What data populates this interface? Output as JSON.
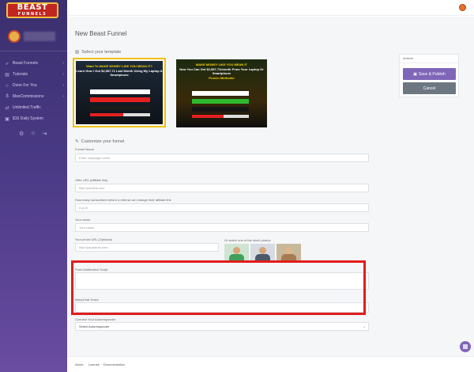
{
  "brand": {
    "line1": "BEAST",
    "line2": "FUNNELS"
  },
  "sidebar": {
    "items": [
      {
        "label": "Beast Funnels",
        "icon": "rocket-icon"
      },
      {
        "label": "Tutorials",
        "icon": "book-icon"
      },
      {
        "label": "Done For You",
        "icon": "star-icon"
      },
      {
        "label": "MaxCommissions",
        "icon": "dollar-icon"
      },
      {
        "label": "Unlimited Traffic",
        "icon": "traffic-icon"
      },
      {
        "label": "$16 Daily System",
        "icon": "money-icon"
      }
    ],
    "tools": [
      "gear-icon",
      "user-icon",
      "logout-icon"
    ]
  },
  "page": {
    "title": "New Beast Funnel"
  },
  "template_section": {
    "label": "Select your template"
  },
  "templates": [
    {
      "headline": "Want To MAKE MONEY LIKE YOU MEAN IT?",
      "sub": "Learn How I Got $2,587.71 Last Month Using My Laptop & Smartphone",
      "button": "GET Yours Free"
    },
    {
      "headline": "MAKE MONEY LIKE YOU MEAN IT",
      "sub": "Now You Can Get $2,587.71/month From Your Laptop Or Smartphone",
      "proven": "Proven Methods!",
      "button": "GET Yours Free"
    }
  ],
  "actions": {
    "title": "Actions",
    "save": "Save & Publish",
    "cancel": "Cancel"
  },
  "customize": {
    "label": "Customize your funnel"
  },
  "form": {
    "funnel_name": {
      "label": "Funnel Name",
      "placeholder": "Enter campaign name"
    },
    "offer_url": {
      "label": "Offer URL (affiliate link)",
      "placeholder": "http://yourlink.com"
    },
    "subscribers": {
      "label": "How many subscribers before a referral can change their affiliate link",
      "placeholder": "e.g 10"
    },
    "your_name": {
      "label": "Your name",
      "placeholder": "Your name"
    },
    "photo_url": {
      "label": "Your photo URL (Optional)",
      "placeholder": "http://yourphoto.com"
    },
    "stock_label": "Or select one of the stock photos",
    "push_script": {
      "label": "Push Notification Script"
    },
    "manychat_script": {
      "label": "ManyChat Script"
    },
    "autoresponder": {
      "label": "Connect Your Autoresponder",
      "value": "Select Autoresponder"
    }
  },
  "footer": {
    "links": [
      "About",
      "License",
      "Documentation"
    ]
  },
  "colors": {
    "accent": "#7f66b8",
    "highlight": "#e11d1d",
    "selected_template_border": "#f0c000"
  }
}
